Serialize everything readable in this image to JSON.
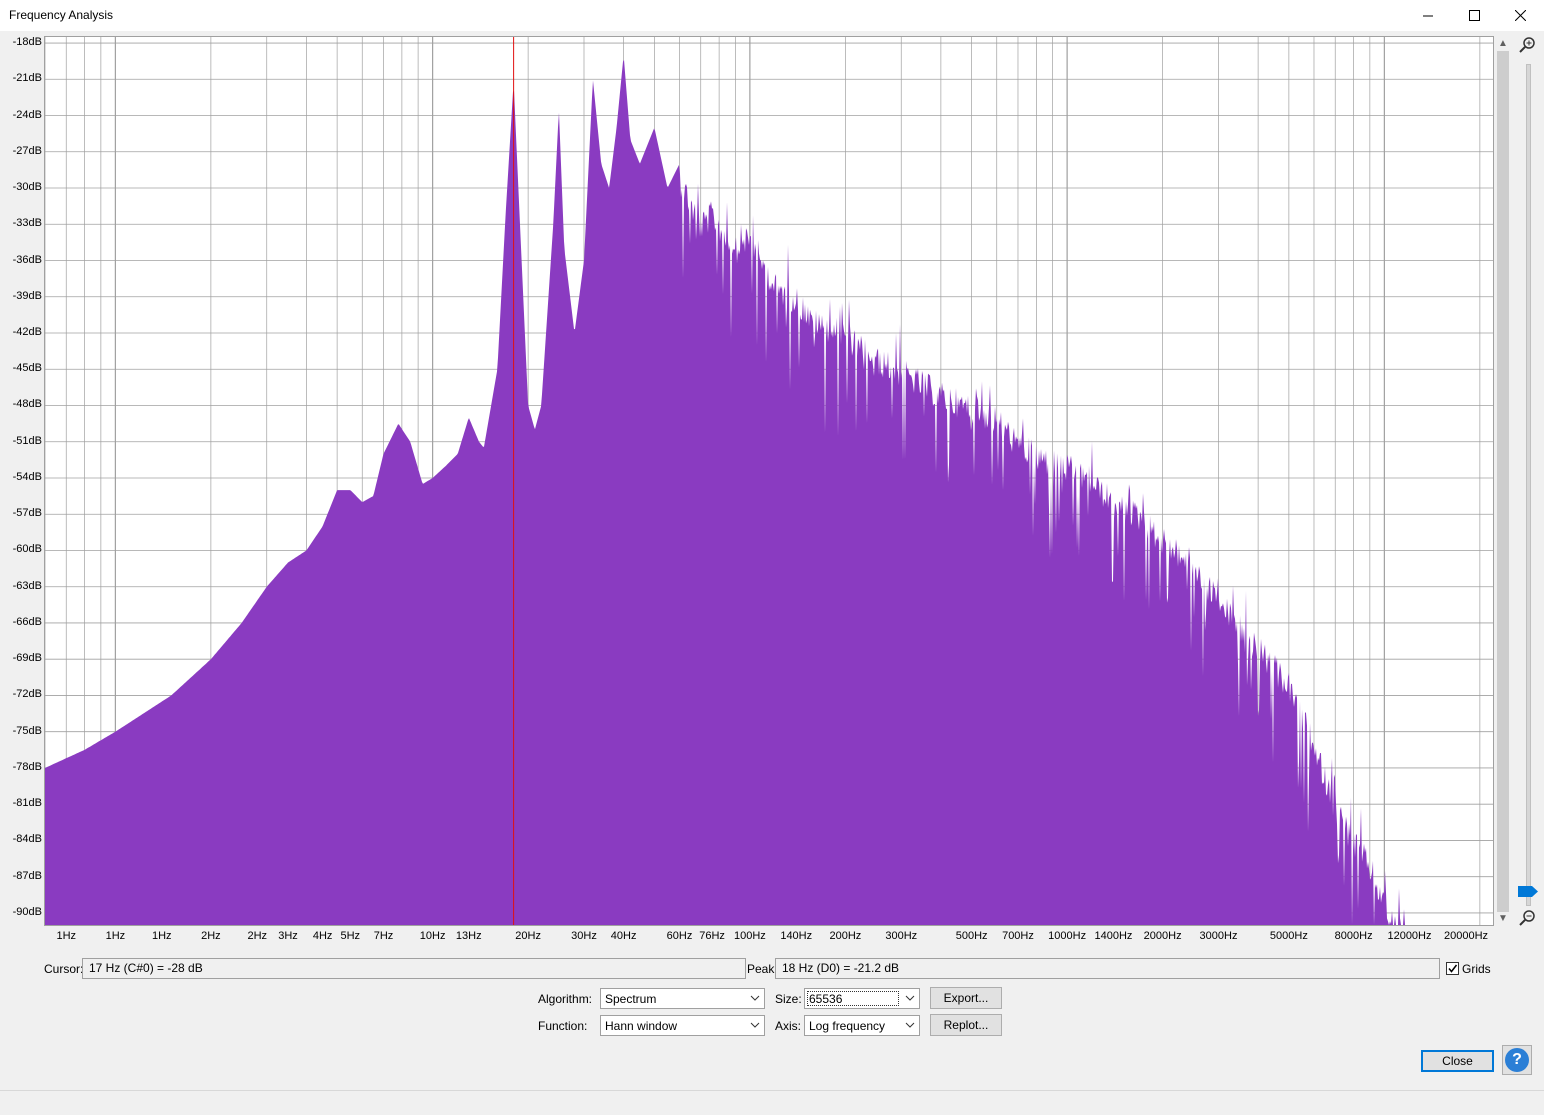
{
  "window": {
    "title": "Frequency Analysis"
  },
  "colors": {
    "spectrum": "#8a3bc1",
    "cursor_line": "#e01010",
    "grid": "#a0a0a0",
    "accent": "#0078d7"
  },
  "chart_data": {
    "type": "area",
    "ylabel_ticks": [
      "-18dB",
      "-21dB",
      "-24dB",
      "-27dB",
      "-30dB",
      "-33dB",
      "-36dB",
      "-39dB",
      "-42dB",
      "-45dB",
      "-48dB",
      "-51dB",
      "-54dB",
      "-57dB",
      "-60dB",
      "-63dB",
      "-66dB",
      "-69dB",
      "-72dB",
      "-75dB",
      "-78dB",
      "-81dB",
      "-84dB",
      "-87dB",
      "-90dB"
    ],
    "y_range_db": [
      -91,
      -17.5
    ],
    "x_scale": "log",
    "x_range_hz": [
      0.6,
      22000
    ],
    "x_tick_labels": [
      {
        "text": "1Hz",
        "hz": 0.7
      },
      {
        "text": "1Hz",
        "hz": 1.0
      },
      {
        "text": "1Hz",
        "hz": 1.4
      },
      {
        "text": "2Hz",
        "hz": 2
      },
      {
        "text": "2Hz",
        "hz": 2.8
      },
      {
        "text": "3Hz",
        "hz": 3.5
      },
      {
        "text": "4Hz",
        "hz": 4.5
      },
      {
        "text": "5Hz",
        "hz": 5.5
      },
      {
        "text": "7Hz",
        "hz": 7
      },
      {
        "text": "10Hz",
        "hz": 10
      },
      {
        "text": "13Hz",
        "hz": 13
      },
      {
        "text": "20Hz",
        "hz": 20
      },
      {
        "text": "30Hz",
        "hz": 30
      },
      {
        "text": "40Hz",
        "hz": 40
      },
      {
        "text": "60Hz",
        "hz": 60
      },
      {
        "text": "76Hz",
        "hz": 76
      },
      {
        "text": "100Hz",
        "hz": 100
      },
      {
        "text": "140Hz",
        "hz": 140
      },
      {
        "text": "200Hz",
        "hz": 200
      },
      {
        "text": "300Hz",
        "hz": 300
      },
      {
        "text": "500Hz",
        "hz": 500
      },
      {
        "text": "700Hz",
        "hz": 700
      },
      {
        "text": "1000Hz",
        "hz": 1000
      },
      {
        "text": "1400Hz",
        "hz": 1400
      },
      {
        "text": "2000Hz",
        "hz": 2000
      },
      {
        "text": "3000Hz",
        "hz": 3000
      },
      {
        "text": "5000Hz",
        "hz": 5000
      },
      {
        "text": "8000Hz",
        "hz": 8000
      },
      {
        "text": "12000Hz",
        "hz": 12000
      },
      {
        "text": "20000Hz",
        "hz": 20000
      }
    ],
    "envelope": [
      [
        0.6,
        -78
      ],
      [
        0.8,
        -76.5
      ],
      [
        1.0,
        -75
      ],
      [
        1.5,
        -72
      ],
      [
        2,
        -69
      ],
      [
        2.5,
        -66
      ],
      [
        3,
        -63
      ],
      [
        3.5,
        -61
      ],
      [
        4,
        -60
      ],
      [
        4.5,
        -58
      ],
      [
        5,
        -55
      ],
      [
        5.5,
        -55
      ],
      [
        6,
        -56
      ],
      [
        6.5,
        -55.5
      ],
      [
        7,
        -52
      ],
      [
        7.8,
        -49.5
      ],
      [
        8.5,
        -51
      ],
      [
        9.3,
        -54.5
      ],
      [
        10,
        -54
      ],
      [
        11,
        -53
      ],
      [
        12,
        -52
      ],
      [
        13,
        -49
      ],
      [
        14,
        -51
      ],
      [
        14.5,
        -51.5
      ],
      [
        16,
        -45
      ],
      [
        17,
        -32
      ],
      [
        18,
        -21.2
      ],
      [
        19,
        -35
      ],
      [
        20,
        -48
      ],
      [
        21,
        -50
      ],
      [
        22,
        -48
      ],
      [
        24,
        -33
      ],
      [
        25,
        -23.5
      ],
      [
        26,
        -35
      ],
      [
        28,
        -42
      ],
      [
        30,
        -36
      ],
      [
        32,
        -21
      ],
      [
        34,
        -28
      ],
      [
        36,
        -30
      ],
      [
        38,
        -25
      ],
      [
        40,
        -19
      ],
      [
        42,
        -26
      ],
      [
        45,
        -28
      ],
      [
        50,
        -25
      ],
      [
        55,
        -30
      ],
      [
        60,
        -28
      ],
      [
        65,
        -30
      ],
      [
        70,
        -32
      ],
      [
        76,
        -31
      ],
      [
        85,
        -33
      ],
      [
        100,
        -33
      ],
      [
        120,
        -37
      ],
      [
        140,
        -38
      ],
      [
        160,
        -40
      ],
      [
        200,
        -41
      ],
      [
        250,
        -43
      ],
      [
        300,
        -44
      ],
      [
        400,
        -46
      ],
      [
        500,
        -47
      ],
      [
        600,
        -48
      ],
      [
        700,
        -50
      ],
      [
        800,
        -51
      ],
      [
        1000,
        -52
      ],
      [
        1200,
        -53
      ],
      [
        1400,
        -55
      ],
      [
        1700,
        -56
      ],
      [
        2000,
        -58
      ],
      [
        2500,
        -60
      ],
      [
        3000,
        -63
      ],
      [
        4000,
        -67
      ],
      [
        5000,
        -70
      ],
      [
        6000,
        -75
      ],
      [
        7000,
        -80
      ],
      [
        8000,
        -83
      ],
      [
        9000,
        -85
      ],
      [
        10000,
        -88
      ],
      [
        11000,
        -90
      ],
      [
        11800,
        -91
      ]
    ],
    "peak_marker_hz": 18
  },
  "readouts": {
    "cursor_label": "Cursor:",
    "cursor_value": "17 Hz (C#0) = -28 dB",
    "peak_label": "Peak:",
    "peak_value": "18 Hz (D0) = -21.2 dB",
    "grids_label": "Grids",
    "grids_checked": true
  },
  "controls": {
    "algorithm_label": "Algorithm:",
    "algorithm_value": "Spectrum",
    "size_label": "Size:",
    "size_value": "65536",
    "function_label": "Function:",
    "function_value": "Hann window",
    "axis_label": "Axis:",
    "axis_value": "Log frequency",
    "export_label": "Export...",
    "replot_label": "Replot...",
    "close_label": "Close",
    "help_label": "?"
  }
}
